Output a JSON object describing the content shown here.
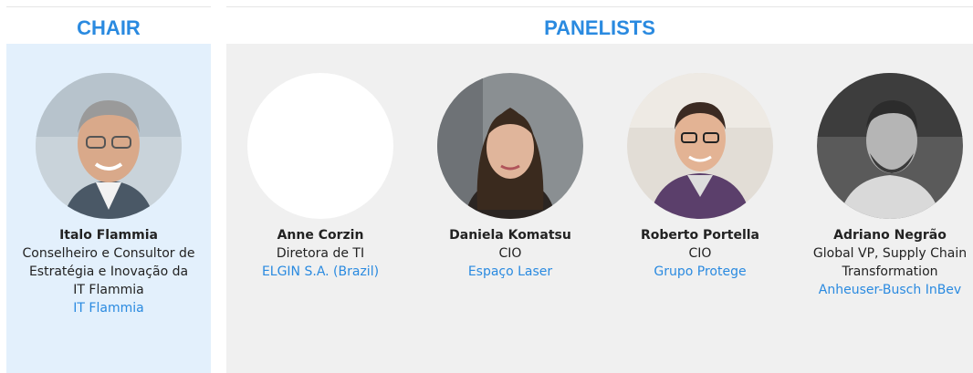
{
  "chair": {
    "heading": "CHAIR",
    "person": {
      "name": "Italo Flammia",
      "role": "Conselheiro e Consultor de Estratégia e Inovação da IT Flammia",
      "company": "IT Flammia"
    }
  },
  "panelists": {
    "heading": "PANELISTS",
    "people": [
      {
        "name": "Anne Corzin",
        "role": "Diretora de TI",
        "company": "ELGIN S.A. (Brazil)"
      },
      {
        "name": "Daniela Komatsu",
        "role": "CIO",
        "company": "Espaço Laser"
      },
      {
        "name": "Roberto Portella",
        "role": "CIO",
        "company": "Grupo Protege"
      },
      {
        "name": "Adriano Negrão",
        "role": "Global VP, Supply Chain Transformation",
        "company": "Anheuser-Busch InBev"
      }
    ]
  },
  "colors": {
    "accent": "#2a8ae0",
    "chair_bg": "#e3f0fc",
    "panel_bg": "#f0f0f0"
  }
}
